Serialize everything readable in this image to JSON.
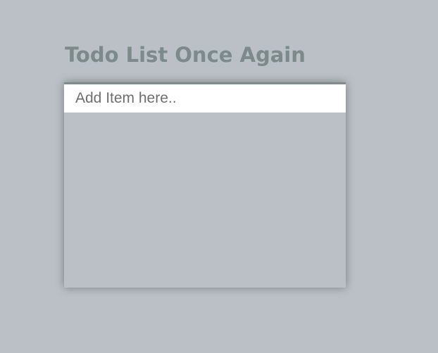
{
  "header": {
    "title": "Todo List Once Again"
  },
  "todo": {
    "input": {
      "placeholder": "Add Item here..",
      "value": ""
    },
    "items": []
  }
}
